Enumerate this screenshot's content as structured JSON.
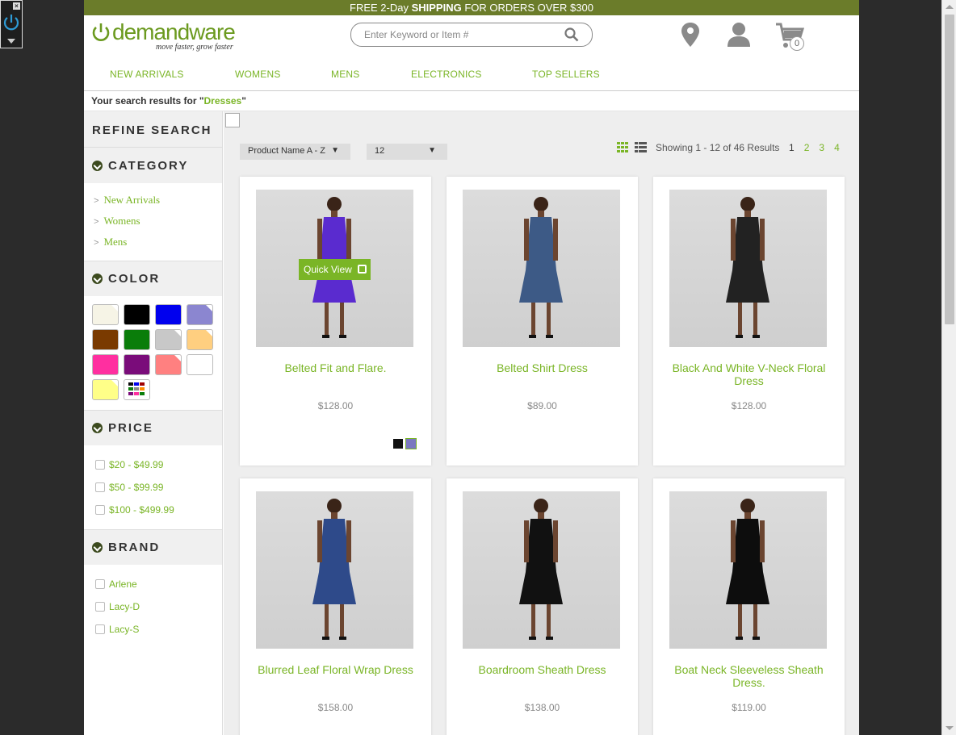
{
  "promo": {
    "prefix": "FREE 2-Day ",
    "bold": "SHIPPING",
    "suffix": " FOR ORDERS OVER $300"
  },
  "logo": {
    "word": "demandware",
    "tagline": "move faster, grow faster"
  },
  "search": {
    "placeholder": "Enter Keyword or Item #"
  },
  "cart": {
    "count": "0"
  },
  "nav": [
    "NEW ARRIVALS",
    "WOMENS",
    "MENS",
    "ELECTRONICS",
    "TOP SELLERS"
  ],
  "results": {
    "prefix": "Your search results for \"",
    "query": "Dresses",
    "suffix": "\""
  },
  "sidebar": {
    "refine_title": "REFINE SEARCH",
    "category": {
      "title": "CATEGORY",
      "items": [
        "New Arrivals",
        "Womens",
        "Mens"
      ]
    },
    "color": {
      "title": "COLOR",
      "swatches": [
        "#f6f4e6",
        "#000000",
        "#0000ee",
        "#8b86d0",
        "#7a3a00",
        "#0a7d0a",
        "#c8c8c8",
        "#ffcf80",
        "#ff2fa0",
        "#7a0c7a",
        "#ff8080",
        "#ffffff",
        "#ffff88",
        "multicolor"
      ]
    },
    "price": {
      "title": "PRICE",
      "items": [
        "$20 - $49.99",
        "$50 - $99.99",
        "$100 - $499.99"
      ]
    },
    "brand": {
      "title": "BRAND",
      "items": [
        "Arlene",
        "Lacy-D",
        "Lacy-S"
      ]
    }
  },
  "toolbar": {
    "sort": "Product Name A - Z",
    "per_page": "12",
    "showing": "Showing 1 - 12 of 46 Results",
    "pages": [
      "1",
      "2",
      "3",
      "4"
    ],
    "current_page": "1"
  },
  "quick_view": "Quick View",
  "products": [
    {
      "name": "Belted Fit and Flare.",
      "price": "$128.00",
      "dress_color": "#5a2bcf",
      "swatches": [
        "#111111",
        "#7b78c0"
      ]
    },
    {
      "name": "Belted Shirt Dress",
      "price": "$89.00",
      "dress_color": "#3d5a86"
    },
    {
      "name": "Black And White V-Neck Floral Dress",
      "price": "$128.00",
      "dress_color": "#222222"
    },
    {
      "name": "Blurred Leaf Floral Wrap Dress",
      "price": "$158.00",
      "dress_color": "#2e4a8a"
    },
    {
      "name": "Boardroom Sheath Dress",
      "price": "$138.00",
      "dress_color": "#111111"
    },
    {
      "name": "Boat Neck Sleeveless Sheath Dress.",
      "price": "$119.00",
      "dress_color": "#0d0d0d"
    }
  ]
}
